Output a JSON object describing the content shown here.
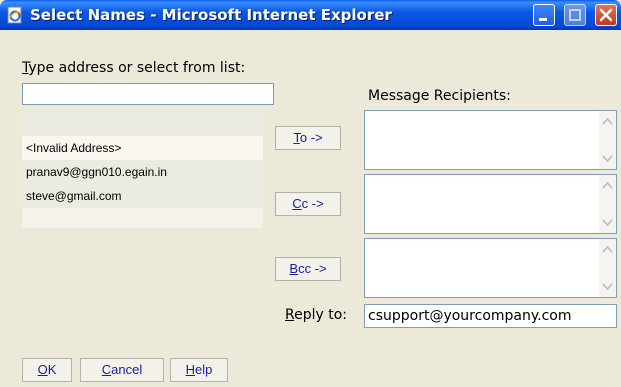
{
  "window": {
    "title": "Select Names - Microsoft Internet Explorer",
    "icon": "ie-page-icon",
    "controls": [
      "minimize-icon",
      "maximize-icon",
      "close-icon"
    ]
  },
  "search": {
    "label_first": "T",
    "label_rest": "ype address or select from list:",
    "value": ""
  },
  "address_list": [
    "",
    "<Invalid Address>",
    "pranav9@ggn010.egain.in",
    "steve@gmail.com"
  ],
  "recipients_label": "Message Recipients:",
  "buttons": {
    "to": {
      "first": "T",
      "rest": "o ->"
    },
    "cc": {
      "first": "C",
      "rest": "c ->"
    },
    "bcc": {
      "first": "B",
      "rest": "cc ->"
    }
  },
  "reply_to": {
    "label_first": "R",
    "label_rest": "eply to:",
    "value": "csupport@yourcompany.com"
  },
  "footer": {
    "ok": {
      "first": "O",
      "rest": "K"
    },
    "cancel": {
      "first": "C",
      "rest": "ancel"
    },
    "help": {
      "first": "H",
      "rest": "elp"
    }
  },
  "colors": {
    "title_bar": "#0a58e4",
    "dialog_bg": "#ece9d8",
    "list_bg": "#f5f3e9",
    "button_text": "#1a1aa6",
    "close_button": "#c13a1c"
  }
}
